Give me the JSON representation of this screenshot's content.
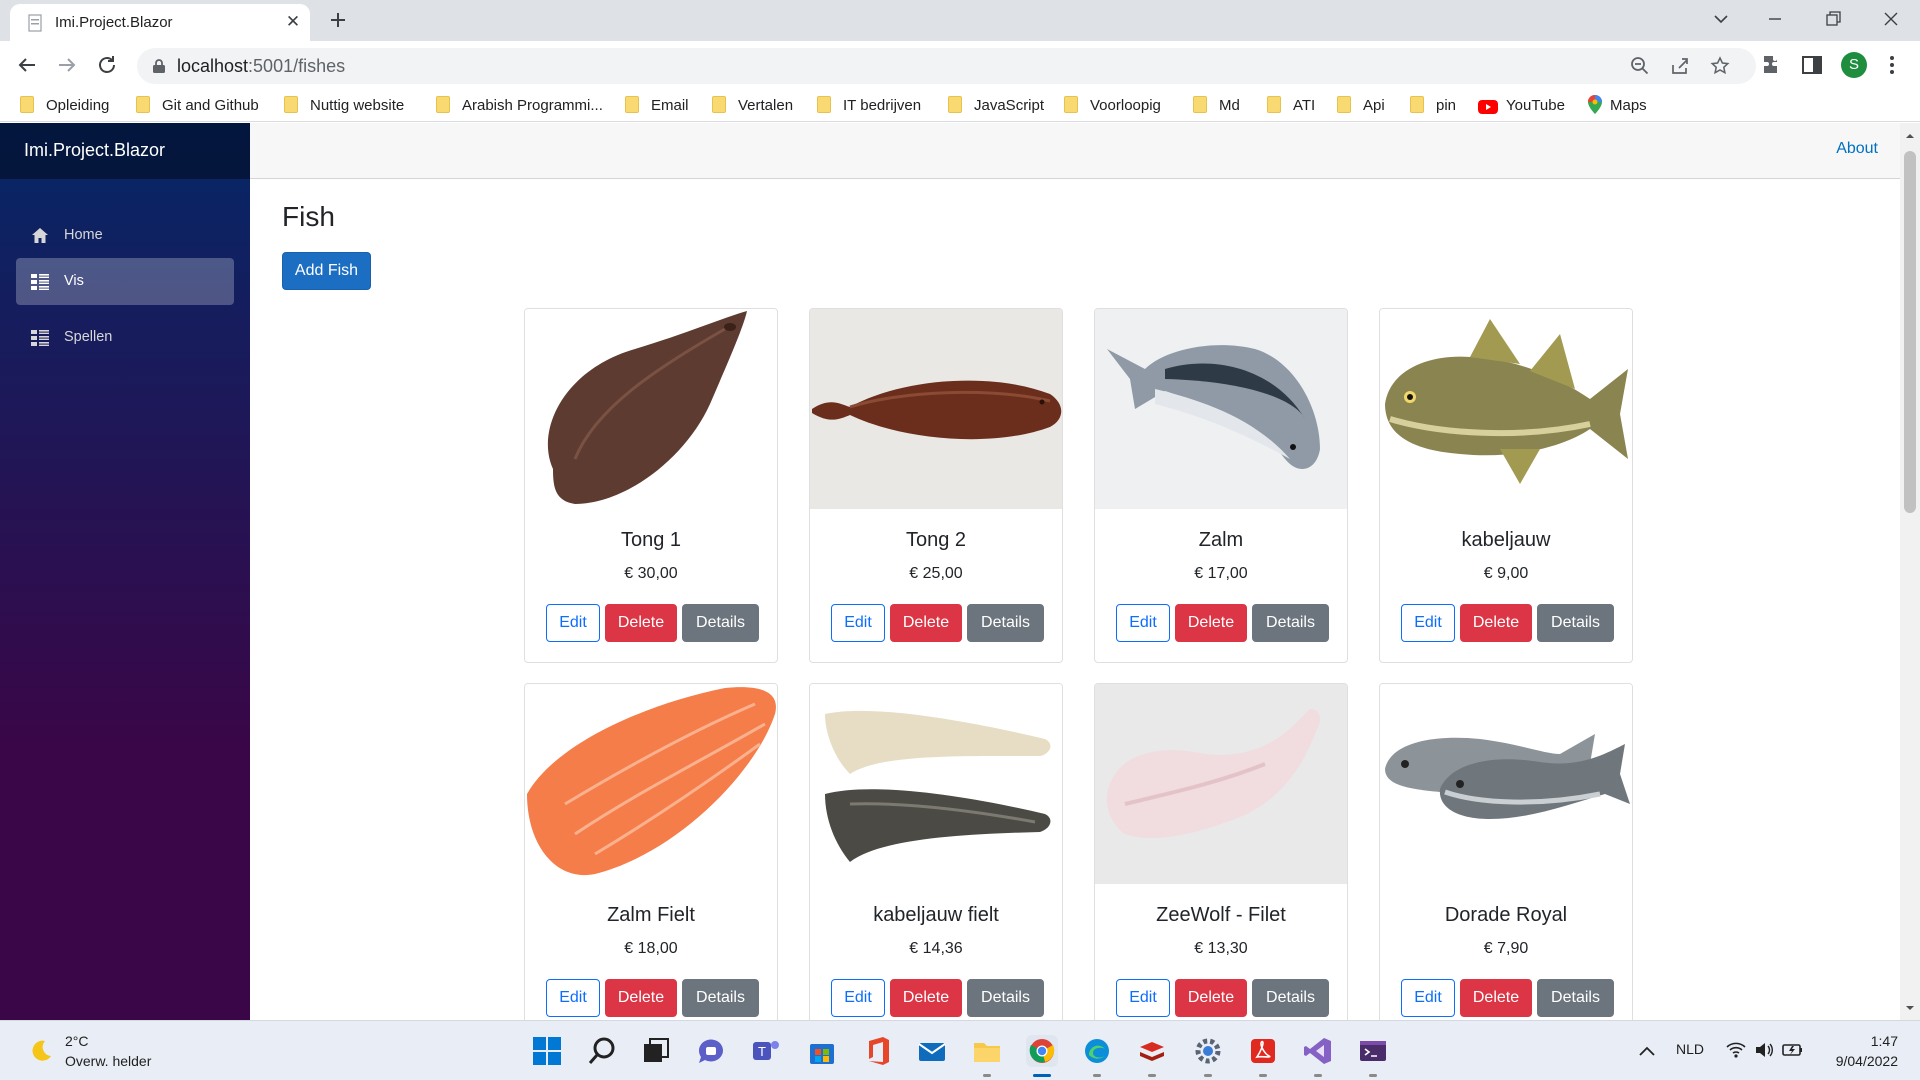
{
  "browser": {
    "tab_title": "Imi.Project.Blazor",
    "url_host": "localhost",
    "url_path": ":5001/fishes",
    "profile_initial": "S",
    "bookmarks": [
      {
        "label": "Opleiding",
        "icon": "folder-icon"
      },
      {
        "label": "Git and Github",
        "icon": "folder-icon"
      },
      {
        "label": "Nuttig website",
        "icon": "folder-icon"
      },
      {
        "label": "Arabish Programmi...",
        "icon": "folder-icon"
      },
      {
        "label": "Email",
        "icon": "folder-icon"
      },
      {
        "label": "Vertalen",
        "icon": "folder-icon"
      },
      {
        "label": "IT bedrijven",
        "icon": "folder-icon"
      },
      {
        "label": "JavaScript",
        "icon": "folder-icon"
      },
      {
        "label": "Voorloopig",
        "icon": "folder-icon"
      },
      {
        "label": "Md",
        "icon": "folder-icon"
      },
      {
        "label": "ATI",
        "icon": "folder-icon"
      },
      {
        "label": "Api",
        "icon": "folder-icon"
      },
      {
        "label": "pin",
        "icon": "folder-icon"
      },
      {
        "label": "YouTube",
        "icon": "youtube-icon"
      },
      {
        "label": "Maps",
        "icon": "maps-icon"
      }
    ]
  },
  "app": {
    "brand": "Imi.Project.Blazor",
    "about_link": "About",
    "nav": [
      {
        "label": "Home",
        "icon": "home-icon",
        "active": false
      },
      {
        "label": "Vis",
        "icon": "list-icon",
        "active": true
      },
      {
        "label": "Spellen",
        "icon": "list-icon",
        "active": false
      }
    ],
    "page_title": "Fish",
    "add_button": "Add Fish",
    "button_labels": {
      "edit": "Edit",
      "delete": "Delete",
      "details": "Details"
    },
    "fishes": [
      {
        "name": "Tong 1",
        "price": "€ 30,00",
        "image": "sole-fish-image"
      },
      {
        "name": "Tong 2",
        "price": "€ 25,00",
        "image": "sole-fish-image"
      },
      {
        "name": "Zalm",
        "price": "€ 17,00",
        "image": "salmon-image"
      },
      {
        "name": "kabeljauw",
        "price": "€ 9,00",
        "image": "cod-image"
      },
      {
        "name": "Zalm Fielt",
        "price": "€ 18,00",
        "image": "salmon-fillet-image"
      },
      {
        "name": "kabeljauw fielt",
        "price": "€ 14,36",
        "image": "cod-fillet-image"
      },
      {
        "name": "ZeeWolf - Filet",
        "price": "€ 13,30",
        "image": "wolffish-fillet-image"
      },
      {
        "name": "Dorade Royal",
        "price": "€ 7,90",
        "image": "sea-bream-image"
      }
    ]
  },
  "taskbar": {
    "weather_temp": "2°C",
    "weather_desc": "Overw. helder",
    "language": "NLD",
    "time": "1:47",
    "date": "9/04/2022"
  },
  "colors": {
    "primary": "#1b6ec2",
    "danger": "#dc3545",
    "secondary": "#6c757d",
    "link": "#0071c1",
    "sidebar_top": "#052767",
    "sidebar_bottom": "#3a0647"
  }
}
